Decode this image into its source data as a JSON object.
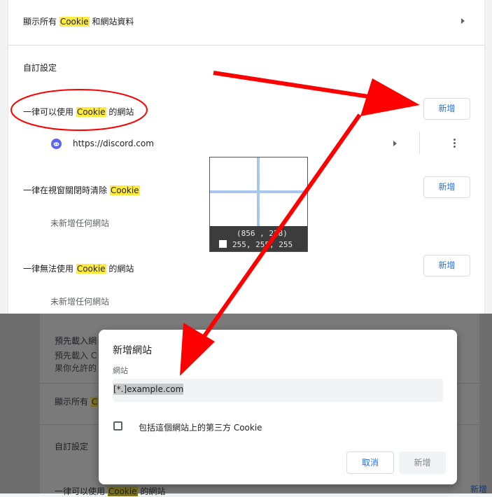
{
  "top_row": {
    "label_pre": "顯示所有 ",
    "label_hl": "Cookie",
    "label_post": " 和網站資料"
  },
  "custom_section": {
    "title": "自訂設定"
  },
  "allow": {
    "label_pre": "一律可以使用 ",
    "label_hl": "Cookie",
    "label_post": " 的網站",
    "add_label": "新增",
    "sites": [
      {
        "url": "https://discord.com",
        "icon": "discord-icon"
      }
    ]
  },
  "clear_on_exit": {
    "label_pre": "一律在視窗關閉時清除 ",
    "label_hl": "Cookie",
    "label_post": "",
    "add_label": "新增",
    "empty": "未新增任何網站"
  },
  "block": {
    "label_pre": "一律無法使用 ",
    "label_hl": "Cookie",
    "label_post": " 的網站",
    "add_label": "新增",
    "empty": "未新增任何網站"
  },
  "magnifier": {
    "coords": "(856 , 228)",
    "rgb": "255, 255, 255"
  },
  "background_dimmed": {
    "preload_title": "預先載入網",
    "preload_desc1": "預先載入 C",
    "preload_desc2": "果你允許的",
    "show_all_pre": "顯示所有 ",
    "show_all_hl": "C",
    "custom_title": "自訂設定",
    "allow_pre": "一律可以使用 ",
    "allow_hl": "Cookie",
    "allow_post": " 的網站",
    "add_label": "新增"
  },
  "dialog": {
    "title": "新增網站",
    "field_label": "網站",
    "input_placeholder": "[*.]example.com",
    "checkbox_label": "包括這個網站上的第三方 Cookie",
    "cancel_label": "取消",
    "add_label": "新增"
  },
  "colors": {
    "highlight": "#ffeb3b",
    "accent": "#1a73e8",
    "annotation": "#ff0000"
  }
}
